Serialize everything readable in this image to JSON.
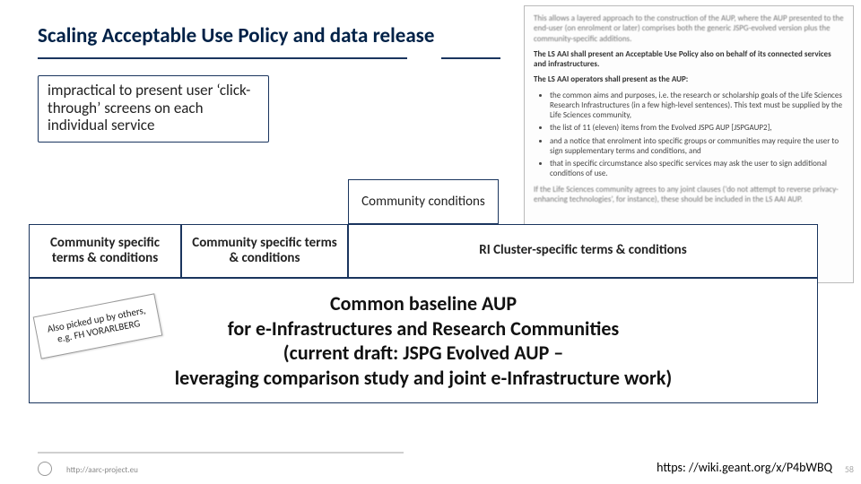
{
  "title": "Scaling Acceptable Use Policy and data release",
  "callout": "impractical to present user ‘click-through’ screens on each individual service",
  "tiers": {
    "community_conditions": "Community conditions",
    "left": "Community specific terms & conditions",
    "mid": "Community specific terms & conditions",
    "right": "RI Cluster-specific terms & conditions"
  },
  "base_aup": "Common baseline AUP\nfor e-Infrastructures and Research Communities\n(current draft: JSPG Evolved AUP –\nleveraging comparison study and joint e-Infrastructure work)",
  "sticky": "Also picked up by others, e.g. FH VORARLBERG",
  "doc": {
    "intro": "This allows a layered approach to the construction of the AUP, where the AUP presented to the end-user (on enrolment or later) comprises both the generic JSPG-evolved version plus the community-specific additions.",
    "line1": "The LS AAI shall present an Acceptable Use Policy also on behalf of its connected services and infrastructures.",
    "line2": "The LS AAI operators shall present as the AUP:",
    "bullets": [
      "the common aims and purposes, i.e. the research or scholarship goals of the Life Sciences Research Infrastructures (in a few high-level sentences). This text must be supplied by the Life Sciences community,",
      "the list of 11 (eleven) items from the Evolved JSPG AUP [JSPGAUP2],",
      "and a notice that enrolment into specific groups or communities may require the user to sign supplementary terms and conditions, and",
      "that in specific circumstance also specific services may ask the user to sign additional conditions of use."
    ],
    "outro": "If the Life Sciences community agrees to any joint clauses (‘do not attempt to reverse privacy-enhancing technologies’, for instance), these should be included in the LS AAI AUP."
  },
  "footer": {
    "url": "http://aarc-project.eu",
    "link": "https: //wiki.geant.org/x/P4bWBQ",
    "page": "58"
  }
}
